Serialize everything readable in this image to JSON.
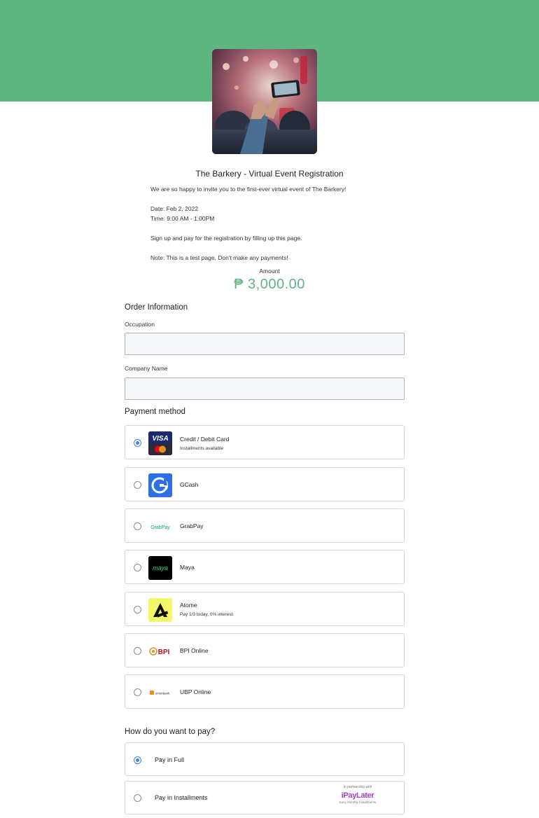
{
  "event": {
    "title": "The Barkery - Virtual Event Registration",
    "description_lines": [
      "We are so happy to invite you to the first-ever virtual event of The Barkery!",
      "Date: Feb 2, 2022",
      "Time: 9:00 AM - 1:00PM",
      "Sign up and pay for the registration by filling up this page.",
      "Note: This is a test page. Don't make any payments!"
    ]
  },
  "amount": {
    "label": "Amount",
    "value": "₱ 3,000.00"
  },
  "order_info": {
    "title": "Order Information",
    "occupation_label": "Occupation",
    "occupation_value": "",
    "company_label": "Company Name",
    "company_value": ""
  },
  "payment_method": {
    "title": "Payment method",
    "options": [
      {
        "label": "Credit / Debit Card",
        "sublabel": "Installments available",
        "icon": "visa-mastercard-logo",
        "selected": true
      },
      {
        "label": "GCash",
        "sublabel": "",
        "icon": "gcash-logo",
        "selected": false
      },
      {
        "label": "GrabPay",
        "sublabel": "",
        "icon": "grabpay-logo",
        "selected": false
      },
      {
        "label": "Maya",
        "sublabel": "",
        "icon": "maya-logo",
        "selected": false
      },
      {
        "label": "Atome",
        "sublabel": "Pay 1/3 today, 0% interest.",
        "icon": "atome-logo",
        "selected": false
      },
      {
        "label": "BPI Online",
        "sublabel": "",
        "icon": "bpi-logo",
        "selected": false
      },
      {
        "label": "UBP Online",
        "sublabel": "",
        "icon": "unionbank-logo",
        "selected": false
      }
    ],
    "logo_text": {
      "visa": "VISA",
      "grabpay": "GrabPay",
      "maya": "maya",
      "bpi": "BPI",
      "ubp": "unionbank"
    }
  },
  "pay_plan": {
    "title": "How do you want to pay?",
    "options": [
      {
        "label": "Pay in Full",
        "selected": true
      },
      {
        "label": "Pay in Installments",
        "selected": false
      }
    ],
    "partner": {
      "top": "In partnership with",
      "logo": "iPayLater",
      "bottom": "Easy Monthly Installments"
    }
  },
  "colors": {
    "brand_green": "#5fb57f",
    "radio_blue": "#3b82f6",
    "input_bg": "#f5f7f9"
  }
}
